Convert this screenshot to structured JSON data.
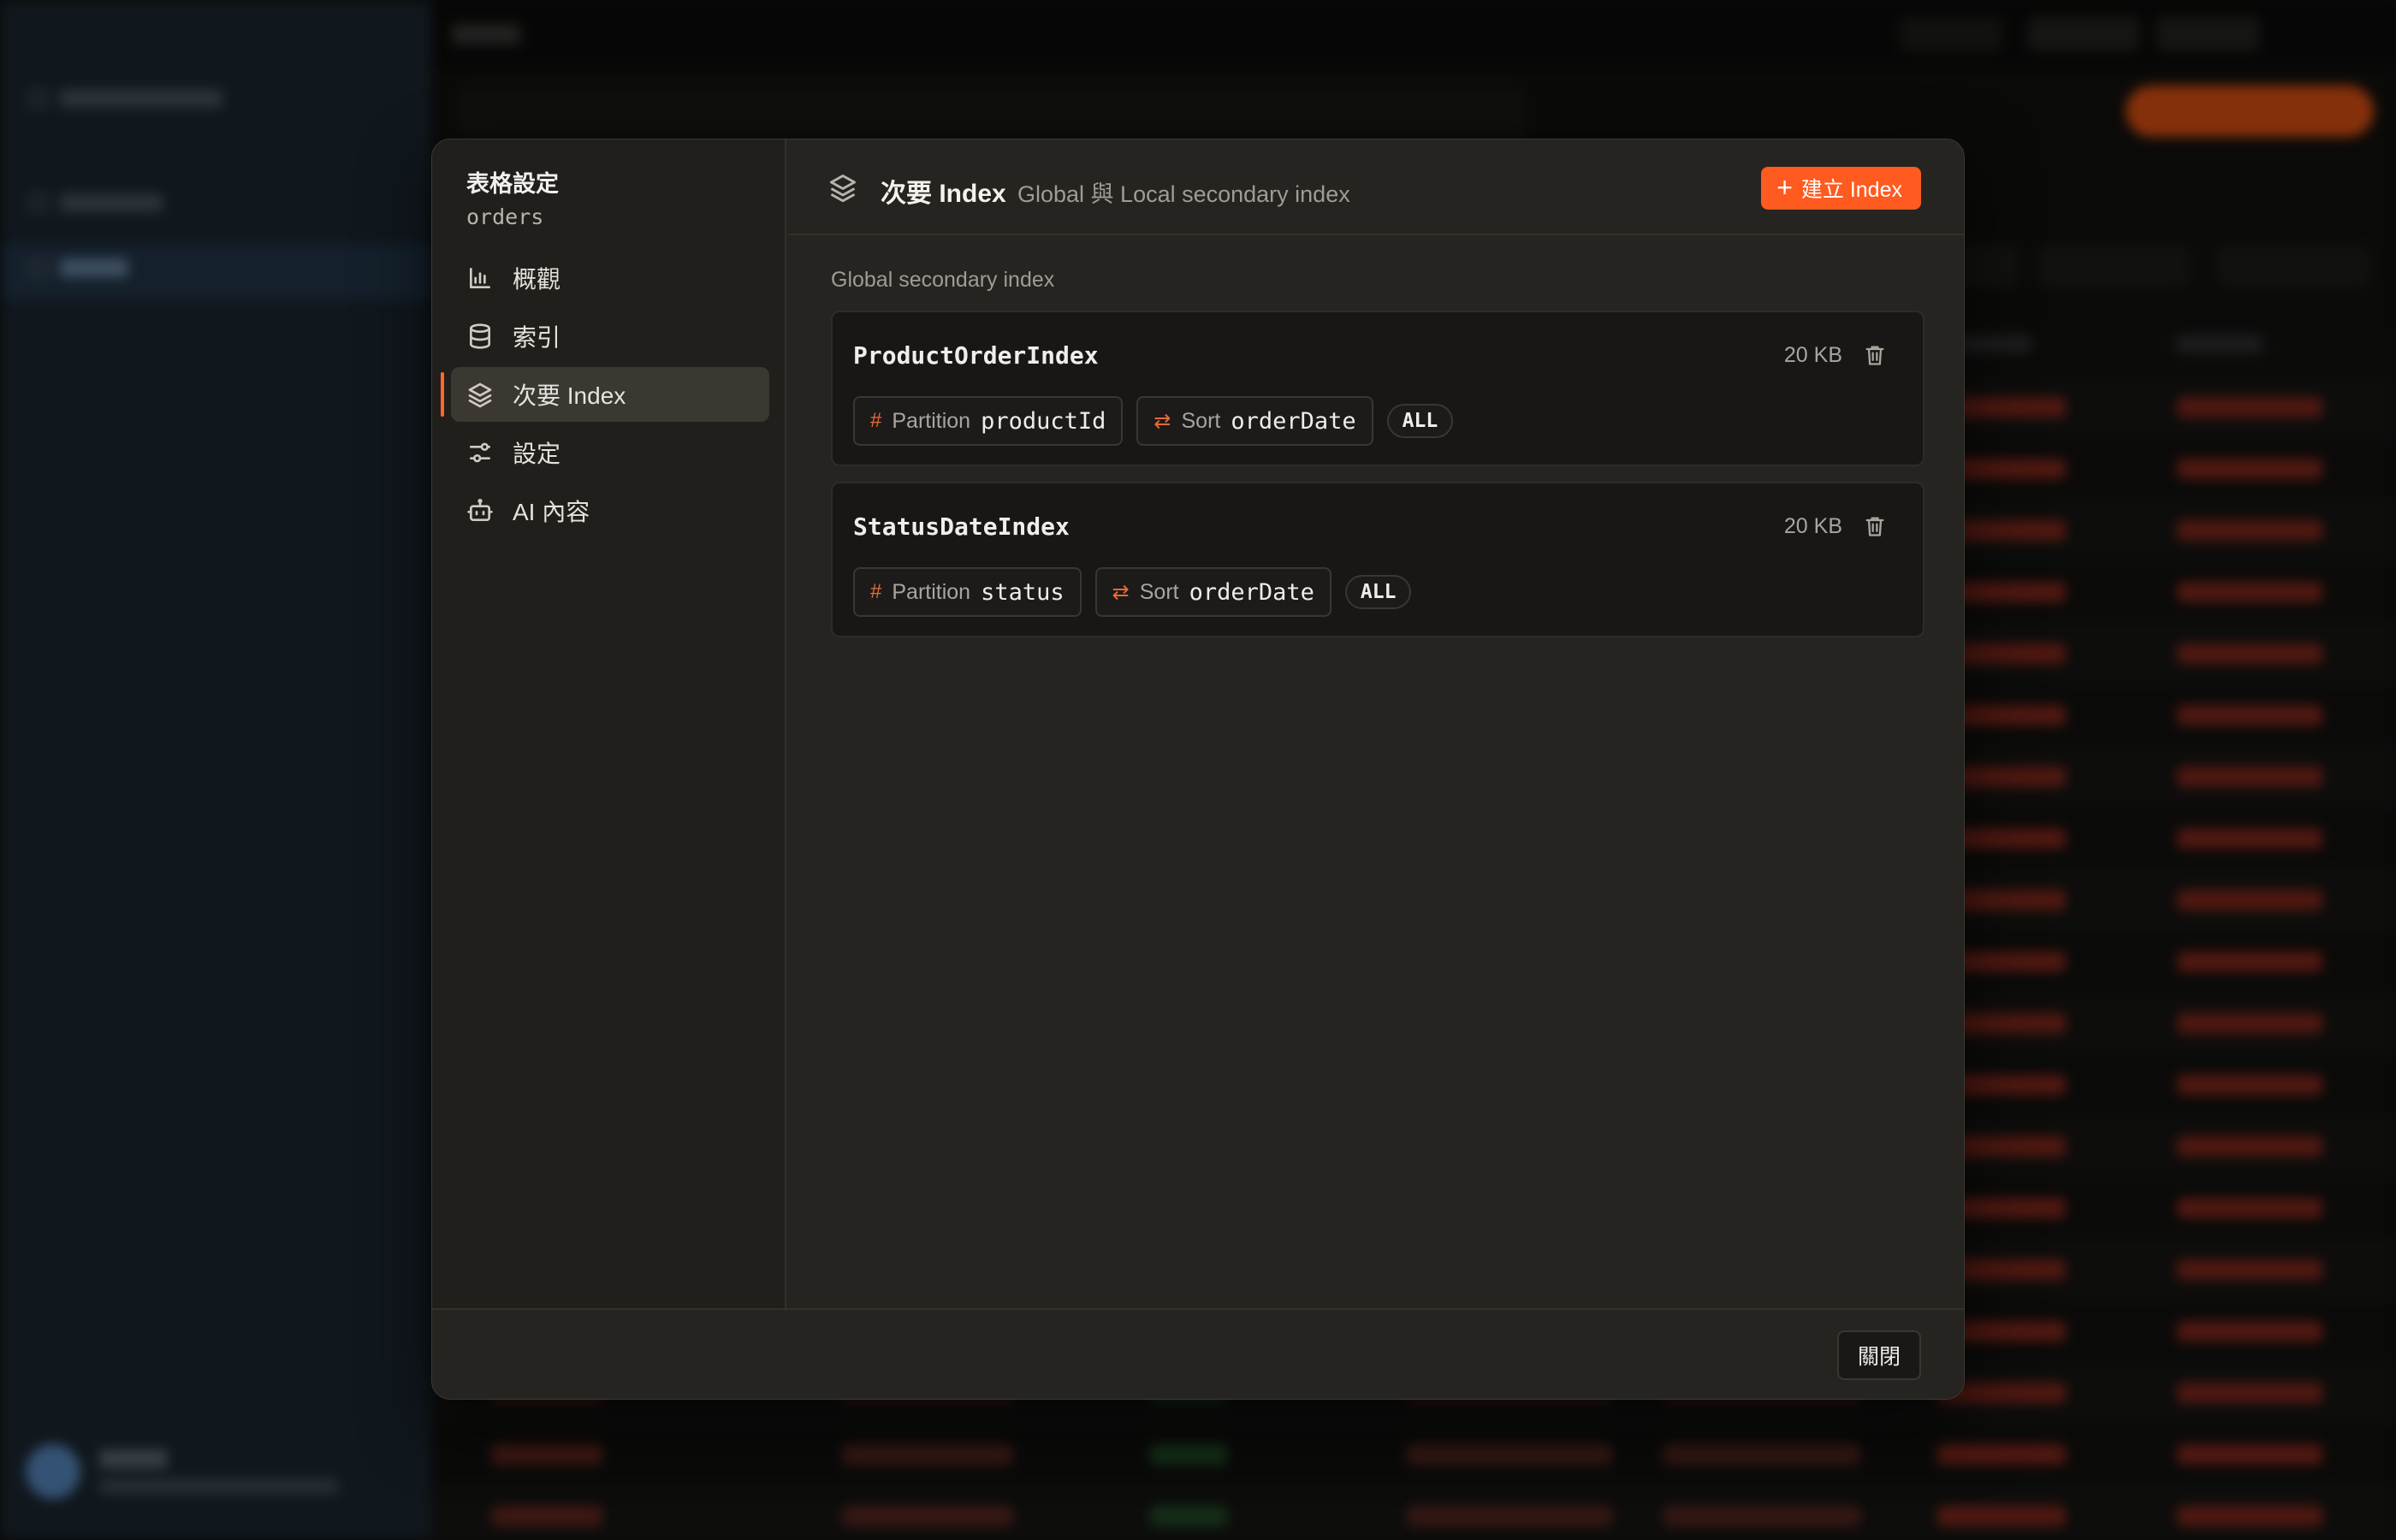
{
  "modal": {
    "title": "表格設定",
    "table_name": "orders",
    "nav": [
      {
        "label": "概觀",
        "icon": "bar-chart-icon"
      },
      {
        "label": "索引",
        "icon": "database-icon"
      },
      {
        "label": "次要 Index",
        "icon": "layers-icon"
      },
      {
        "label": "設定",
        "icon": "sliders-icon"
      },
      {
        "label": "AI 內容",
        "icon": "bot-icon"
      }
    ],
    "active_nav": "次要 Index",
    "header": {
      "title": "次要 Index",
      "subtitle": "Global 與 Local secondary index",
      "create_button": "建立 Index"
    },
    "section_label": "Global secondary index",
    "indexes": [
      {
        "name": "ProductOrderIndex",
        "size": "20 KB",
        "partition_label": "Partition",
        "partition_key": "productId",
        "sort_label": "Sort",
        "sort_key": "orderDate",
        "projection": "ALL"
      },
      {
        "name": "StatusDateIndex",
        "size": "20 KB",
        "partition_label": "Partition",
        "partition_key": "status",
        "sort_label": "Sort",
        "sort_key": "orderDate",
        "projection": "ALL"
      }
    ],
    "close_button": "關閉"
  },
  "colors": {
    "accent": "#ff5a1f",
    "modal_bg": "#262420",
    "card_bg": "#181715"
  }
}
